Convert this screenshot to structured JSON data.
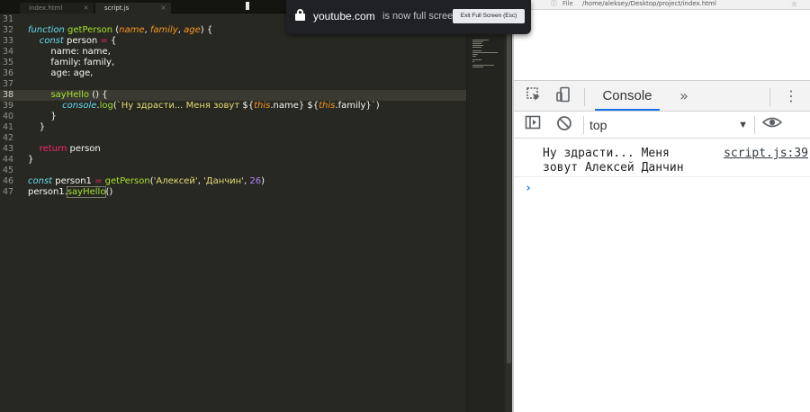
{
  "editor": {
    "tabs": [
      {
        "label": "index.html",
        "active": false
      },
      {
        "label": "script.js",
        "active": true
      }
    ],
    "cursor_line": 38,
    "lines": [
      {
        "n": "31",
        "tokens": []
      },
      {
        "n": "32",
        "tokens": [
          [
            "k",
            "function"
          ],
          [
            "w",
            " "
          ],
          [
            "fn",
            "getPerson"
          ],
          [
            "w",
            " ("
          ],
          [
            "p",
            "name"
          ],
          [
            "w",
            ", "
          ],
          [
            "p",
            "family"
          ],
          [
            "w",
            ", "
          ],
          [
            "p",
            "age"
          ],
          [
            "w",
            ") {"
          ]
        ]
      },
      {
        "n": "33",
        "tokens": [
          [
            "w",
            "    "
          ],
          [
            "k",
            "const"
          ],
          [
            "w",
            " person "
          ],
          [
            "r",
            "="
          ],
          [
            "w",
            " {"
          ]
        ]
      },
      {
        "n": "34",
        "tokens": [
          [
            "w",
            "        name: name,"
          ]
        ]
      },
      {
        "n": "35",
        "tokens": [
          [
            "w",
            "        family: family,"
          ]
        ]
      },
      {
        "n": "36",
        "tokens": [
          [
            "w",
            "        age: age,"
          ]
        ]
      },
      {
        "n": "37",
        "tokens": []
      },
      {
        "n": "38",
        "tokens": [
          [
            "w",
            "        "
          ],
          [
            "fn",
            "sayHello"
          ],
          [
            "w",
            " () {"
          ]
        ]
      },
      {
        "n": "39",
        "tokens": [
          [
            "w",
            "            "
          ],
          [
            "k",
            "console"
          ],
          [
            "w",
            "."
          ],
          [
            "fn",
            "log"
          ],
          [
            "w",
            "("
          ],
          [
            "s",
            "`Ну здрасти... Меня зовут "
          ],
          [
            "w",
            "${"
          ],
          [
            "t",
            "this"
          ],
          [
            "w",
            ".name} ${"
          ],
          [
            "t",
            "this"
          ],
          [
            "w",
            ".family}"
          ],
          [
            "s",
            "`"
          ],
          [
            "w",
            ")"
          ]
        ]
      },
      {
        "n": "40",
        "tokens": [
          [
            "w",
            "        }"
          ]
        ]
      },
      {
        "n": "41",
        "tokens": [
          [
            "w",
            "    }"
          ]
        ]
      },
      {
        "n": "42",
        "tokens": []
      },
      {
        "n": "43",
        "tokens": [
          [
            "w",
            "    "
          ],
          [
            "r",
            "return"
          ],
          [
            "w",
            " person"
          ]
        ]
      },
      {
        "n": "44",
        "tokens": [
          [
            "w",
            "}"
          ]
        ]
      },
      {
        "n": "45",
        "tokens": []
      },
      {
        "n": "46",
        "tokens": [
          [
            "k",
            "const"
          ],
          [
            "w",
            " person1 "
          ],
          [
            "r",
            "="
          ],
          [
            "w",
            " "
          ],
          [
            "fn",
            "getPerson"
          ],
          [
            "w",
            "("
          ],
          [
            "s",
            "'Алексей'"
          ],
          [
            "w",
            ", "
          ],
          [
            "s",
            "'Данчин'"
          ],
          [
            "w",
            ", "
          ],
          [
            "n",
            "26"
          ],
          [
            "w",
            ")"
          ]
        ]
      },
      {
        "n": "47",
        "tokens": [
          [
            "w",
            "person1."
          ],
          [
            "fnbox",
            "sayHello"
          ],
          [
            "w",
            "()"
          ]
        ]
      }
    ]
  },
  "browser": {
    "info_icon": "info-icon",
    "file_label": "File",
    "url": "/home/aleksey/Desktop/project/index.html",
    "star_icon": "star-icon"
  },
  "devtools": {
    "inspect_icon": "inspect-element-icon",
    "device_icon": "device-toolbar-icon",
    "console_tab": "Console",
    "more_tabs": "»",
    "menu_icon": "⋮",
    "sidebar_icon": "show-sidebar-icon",
    "clear_icon": "clear-console-icon",
    "context": "top",
    "context_arrow": "▼",
    "eye_icon": "live-expression-icon",
    "messages": [
      {
        "text": "Ну здрасти... Меня\nзовут Алексей Данчин",
        "source": "script.js:39"
      }
    ],
    "prompt": "›"
  },
  "fullscreen_popup": {
    "site": "youtube.com",
    "message": "is now full screen",
    "exit_button": "Exit Full Screen (Esc)"
  }
}
